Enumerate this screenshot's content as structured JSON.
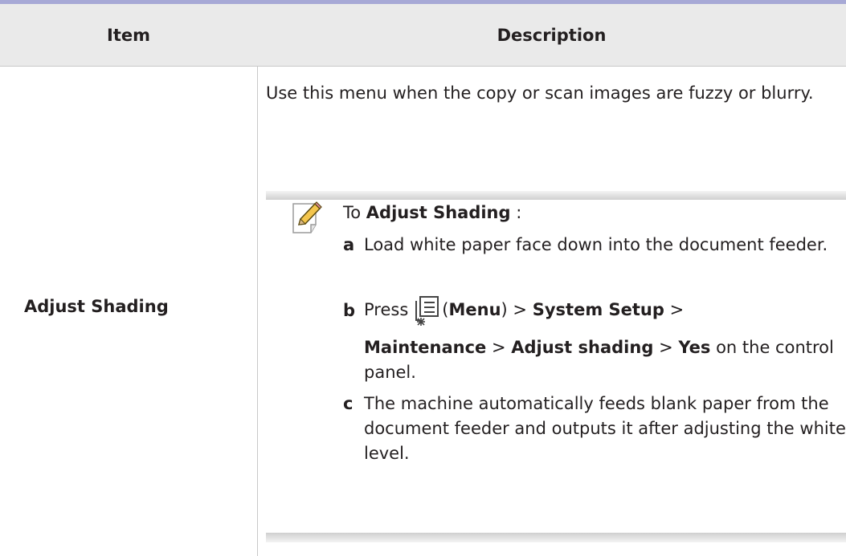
{
  "table": {
    "headers": {
      "item": "Item",
      "description": "Description"
    },
    "row": {
      "item": "Adjust Shading",
      "description": "Use this menu when the copy or scan images are fuzzy or blurry."
    }
  },
  "note": {
    "icon": "note-pencil-icon",
    "title_prefix": "To ",
    "title_bold": "Adjust Shading",
    "title_suffix": " :",
    "steps": [
      {
        "letter": "a",
        "text": "Load white paper face down into the document feeder."
      },
      {
        "letter": "b",
        "press": "Press",
        "menu_icon": "menu-icon",
        "open_paren": "(",
        "menu": "Menu",
        "close_paren": ")",
        "sep": ">",
        "system_setup": "System Setup",
        "maintenance": "Maintenance",
        "adjust_shading": "Adjust shading",
        "yes": "Yes",
        "tail": "on the control panel."
      },
      {
        "letter": "c",
        "text": "The machine automatically feeds blank paper from the document feeder and outputs it after adjusting the white level."
      }
    ]
  },
  "colors": {
    "top_rule": "#a7a9d6",
    "header_bg": "#eaeaea",
    "text": "#231f20"
  }
}
